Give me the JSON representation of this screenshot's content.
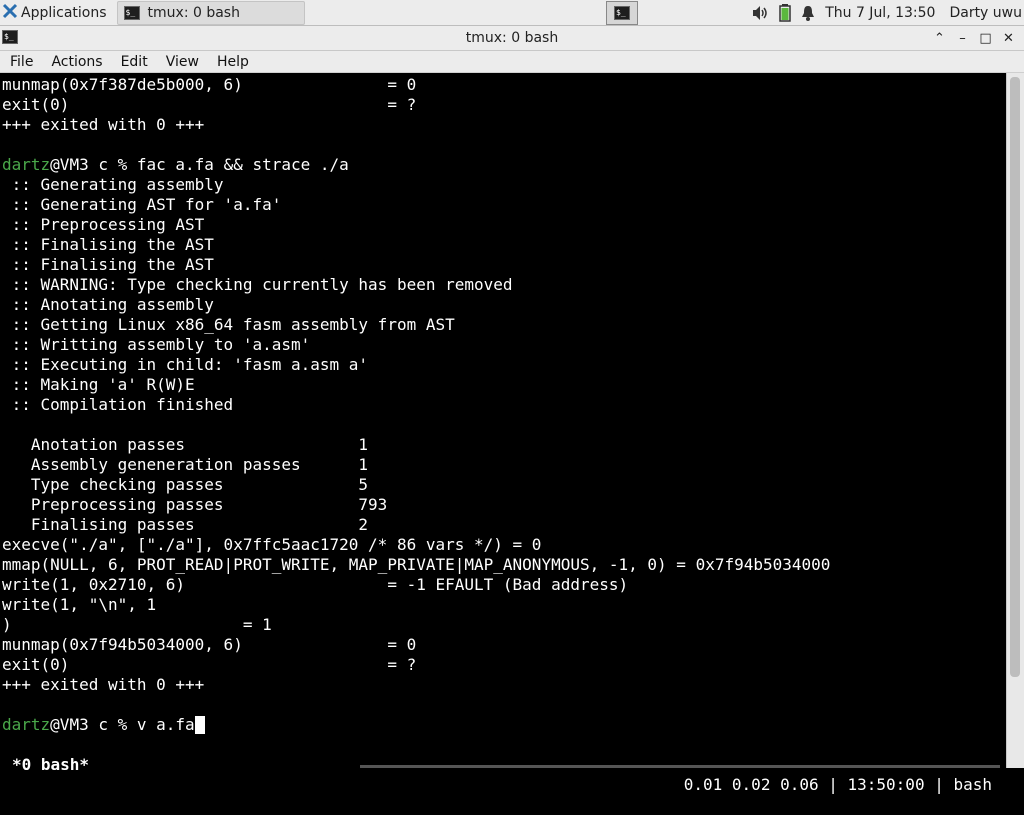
{
  "panel": {
    "apps_label": "Applications",
    "task_label": "tmux: 0 bash",
    "clock": "Thu  7 Jul, 13:50",
    "user": "Darty uwu",
    "icons": [
      "app-menu-icon",
      "terminal-icon",
      "volume-icon",
      "battery-icon",
      "notification-bell-icon"
    ]
  },
  "window": {
    "title": "tmux: 0 bash"
  },
  "menu": [
    "File",
    "Actions",
    "Edit",
    "View",
    "Help"
  ],
  "terminal": {
    "lines": [
      "munmap(0x7f387de5b000, 6)               = 0",
      "exit(0)                                 = ?",
      "+++ exited with 0 +++",
      "",
      "@VM3 c % fac a.fa && strace ./a",
      " :: Generating assembly",
      " :: Generating AST for 'a.fa'",
      " :: Preprocessing AST",
      " :: Finalising the AST",
      " :: Finalising the AST",
      " :: WARNING: Type checking currently has been removed",
      " :: Anotating assembly",
      " :: Getting Linux x86_64 fasm assembly from AST",
      " :: Writting assembly to 'a.asm'",
      " :: Executing in child: 'fasm a.asm a'",
      " :: Making 'a' R(W)E",
      " :: Compilation finished",
      "",
      "   Anotation passes                  1",
      "   Assembly geneneration passes      1",
      "   Type checking passes              5",
      "   Preprocessing passes              793",
      "   Finalising passes                 2",
      "execve(\"./a\", [\"./a\"], 0x7ffc5aac1720 /* 86 vars */) = 0",
      "mmap(NULL, 6, PROT_READ|PROT_WRITE, MAP_PRIVATE|MAP_ANONYMOUS, -1, 0) = 0x7f94b5034000",
      "write(1, 0x2710, 6)                     = -1 EFAULT (Bad address)",
      "write(1, \"\\n\", 1",
      ")                        = 1",
      "munmap(0x7f94b5034000, 6)               = 0",
      "exit(0)                                 = ?",
      "+++ exited with 0 +++",
      "",
      "@VM3 c % v a.fa"
    ],
    "prompt_user": "dartz",
    "prompt_line_indices": [
      4,
      32
    ],
    "user_color": "#4aa84a"
  },
  "tmux": {
    "window": "*0 bash*",
    "status_right": "0.01 0.02 0.06 | 13:50:00 | bash"
  }
}
